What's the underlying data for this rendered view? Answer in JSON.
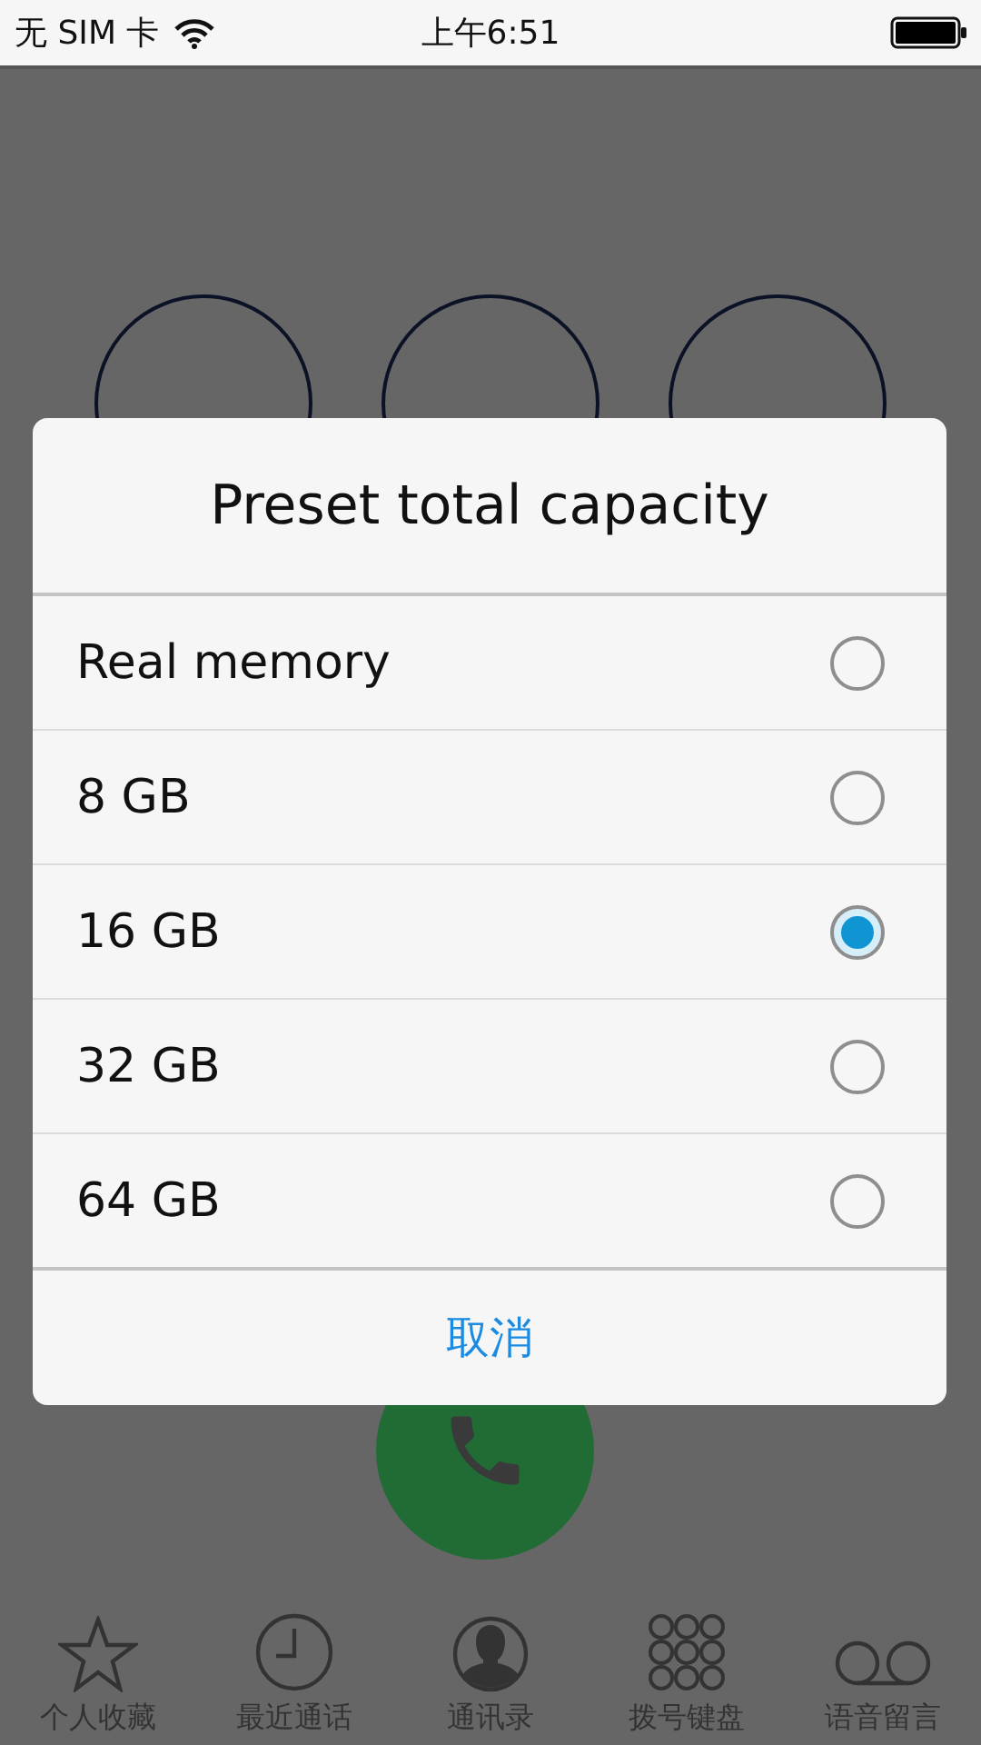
{
  "status_bar": {
    "carrier": "无 SIM 卡",
    "time": "上午6:51"
  },
  "tab_bar": {
    "items": [
      {
        "label": "个人收藏",
        "kind": "star"
      },
      {
        "label": "最近通话",
        "kind": "clock"
      },
      {
        "label": "通讯录",
        "kind": "contact"
      },
      {
        "label": "拨号键盘",
        "kind": "keypad"
      },
      {
        "label": "语音留言",
        "kind": "voicemail"
      }
    ]
  },
  "dialog": {
    "title": "Preset total capacity",
    "options": [
      {
        "label": "Real memory",
        "selected": false
      },
      {
        "label": "8 GB",
        "selected": false
      },
      {
        "label": "16 GB",
        "selected": true
      },
      {
        "label": "32 GB",
        "selected": false
      },
      {
        "label": "64 GB",
        "selected": false
      }
    ],
    "cancel": "取消"
  }
}
